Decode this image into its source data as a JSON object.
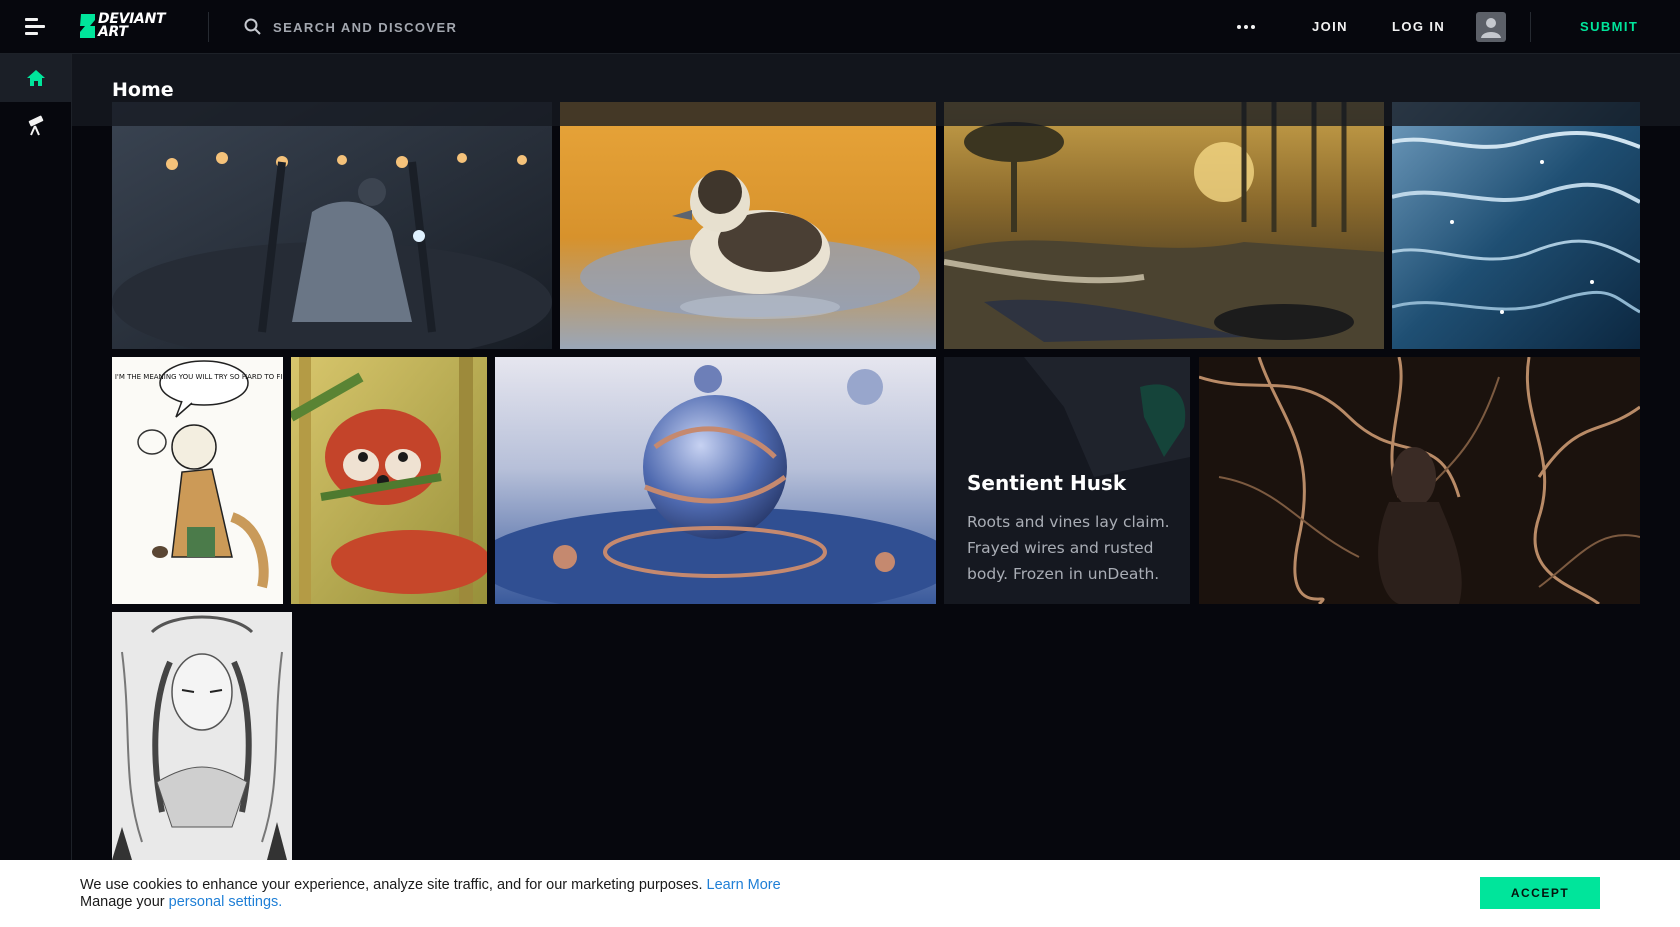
{
  "header": {
    "logo_line1": "DEVIANT",
    "logo_line2": "ART",
    "search_placeholder": "SEARCH AND DISCOVER",
    "join_label": "JOIN",
    "login_label": "LOG IN",
    "submit_label": "SUBMIT"
  },
  "page": {
    "title": "Home"
  },
  "feature_card": {
    "title": "Sentient Husk",
    "description": "Roots and vines lay claim. Frayed wires and rusted body. Frozen in unDeath."
  },
  "comic_bubble": "I'M THE MEANING YOU WILL TRY SO HARD TO FIND",
  "cookie_banner": {
    "text": "We use cookies to enhance your experience, analyze site traffic, and for our marketing purposes.",
    "learn_more": "Learn More",
    "manage_prefix": "Manage your",
    "settings_link": "personal settings.",
    "accept_label": "ACCEPT"
  },
  "colors": {
    "background": "#06070d",
    "accent": "#00e59b",
    "link": "#1f7fd6"
  }
}
